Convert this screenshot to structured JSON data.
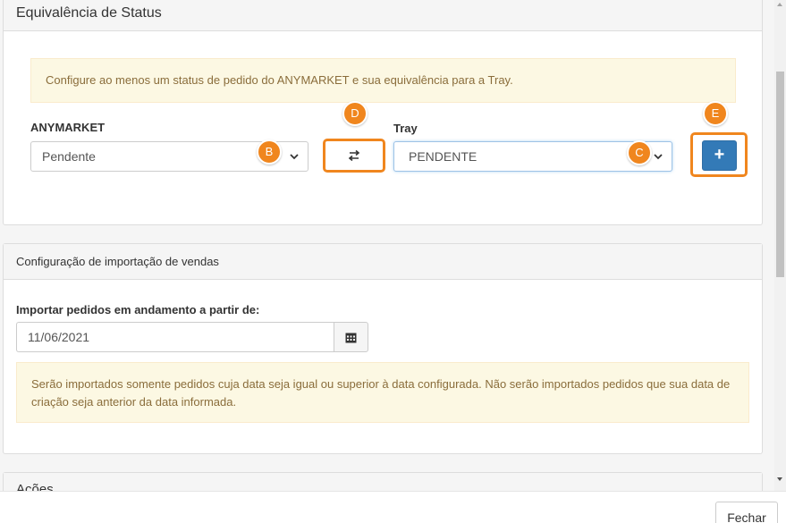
{
  "status_panel": {
    "title": "Equivalência de Status",
    "alert": "Configure ao menos um status de pedido do ANYMARKET e sua equivalência para a Tray.",
    "anymarket_label": "ANYMARKET",
    "anymarket_selected": "Pendente",
    "tray_label": "Tray",
    "tray_selected": "PENDENTE",
    "add_label": "+"
  },
  "callouts": {
    "b": "B",
    "c": "C",
    "d": "D",
    "e": "E",
    "color": "#f0861e"
  },
  "import_panel": {
    "title": "Configuração de importação de vendas",
    "date_label": "Importar pedidos em andamento a partir de:",
    "date_value": "11/06/2021",
    "alert": "Serão importados somente pedidos cuja data seja igual ou superior à data configurada. Não serão importados pedidos que sua data de criação seja anterior da data informada."
  },
  "actions_panel": {
    "title": "Ações"
  },
  "footer": {
    "close_label": "Fechar"
  },
  "colors": {
    "primary": "#337ab7",
    "warning_bg": "#fcf8e3",
    "warning_text": "#8a6d3b",
    "highlight": "#f0861e"
  },
  "icons": {
    "swap": "swap-arrows-icon",
    "calendar": "calendar-icon",
    "chevron": "chevron-down-icon"
  }
}
